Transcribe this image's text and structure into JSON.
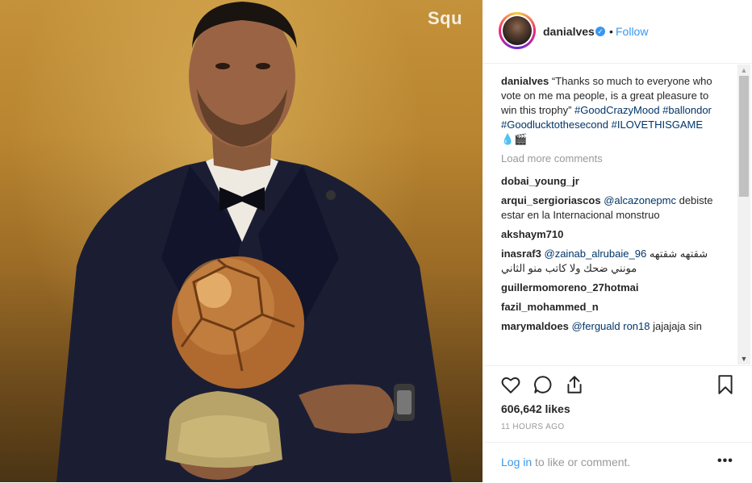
{
  "photo": {
    "watermark": "Squ"
  },
  "post": {
    "username": "danialves",
    "follow_label": "Follow",
    "dot": "•",
    "verified_glyph": "✓"
  },
  "caption": {
    "username": "danialves",
    "text": "“Thanks so much to everyone who vote on me ma people, is a great pleasure to win this trophy” ",
    "emoji_run": "",
    "hashtag1": "#GoodCrazyMood",
    "glyph1": "",
    "hashtag2": "#ballondor",
    "hashtag3": "#Goodlucktothesecond",
    "glyph3": "",
    "hashtag4": "#ILOVETHISGAME",
    "tail_emoji": "💧🎬"
  },
  "load_more": "Load more comments",
  "comments": [
    {
      "user": "dobai_young_jr",
      "text": "",
      "mention": ""
    },
    {
      "user": "arqui_sergioriascos",
      "mention": "@alcazonepmc",
      "text": " debiste estar en la Internacional monstruo"
    },
    {
      "user": "akshaym710",
      "text": "",
      "mention": ""
    },
    {
      "user": "inasraf3",
      "mention": "@zainab_alrubaie_96",
      "text": " شقتهه شقتهه  مونني ضحك ولا كاتب منو الثاني"
    },
    {
      "user": "guillermomoreno_27hotmai",
      "text": "",
      "mention": ""
    },
    {
      "user": "fazil_mohammed_n",
      "text": "",
      "mention": ""
    },
    {
      "user": "marymaldoes",
      "mention": "@ferguald ron18",
      "text": " jajajaja sin"
    }
  ],
  "likes": "606,642 likes",
  "time": "11 HOURS AGO",
  "footer": {
    "login_link": "Log in",
    "login_rest": " to like or comment.",
    "more": "•••"
  },
  "colors": {
    "accent": "#3897f0",
    "hashtag": "#003569",
    "muted": "#999999"
  },
  "icons": [
    "heart-icon",
    "comment-icon",
    "share-icon",
    "bookmark-icon",
    "verified-icon"
  ]
}
